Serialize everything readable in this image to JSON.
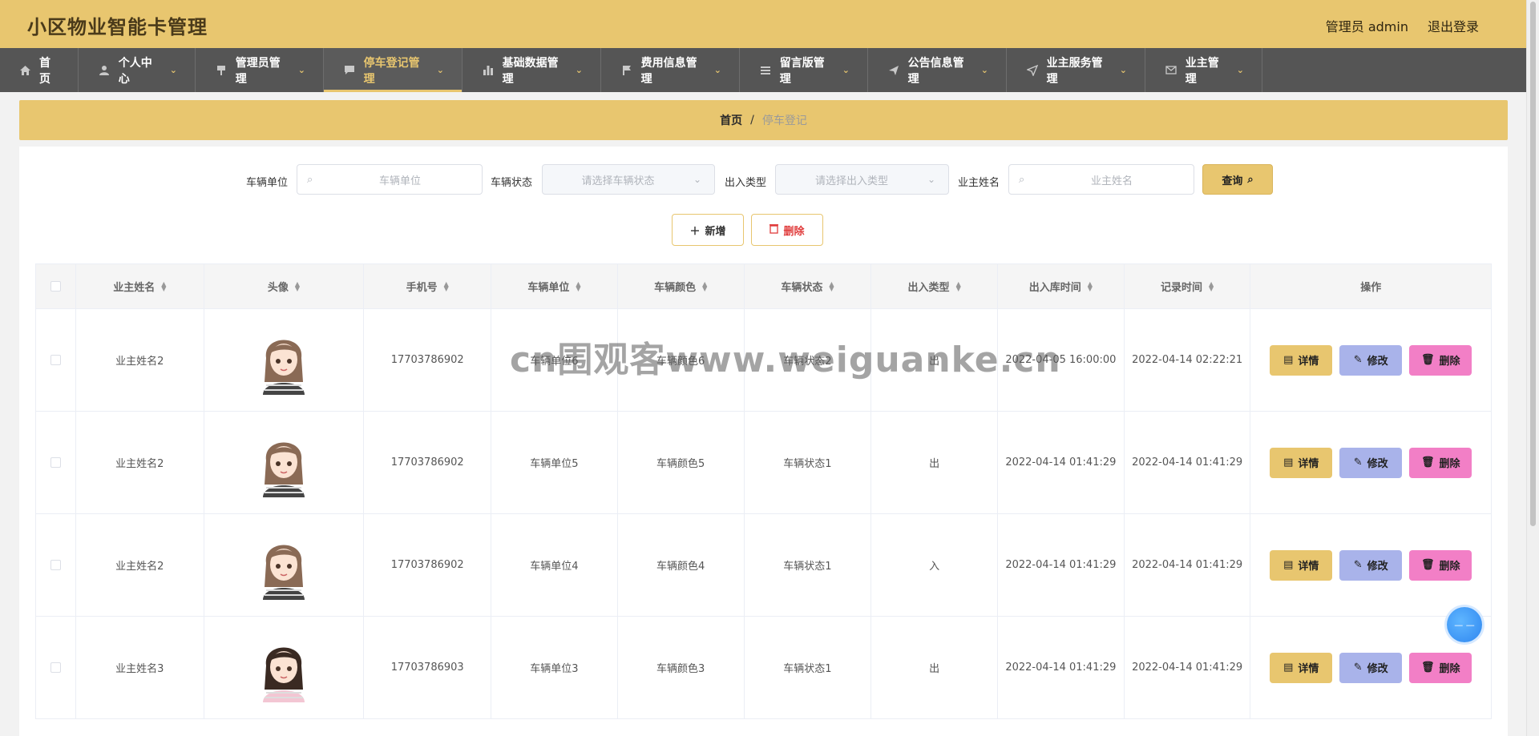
{
  "header": {
    "title": "小区物业智能卡管理",
    "user": "管理员 admin",
    "logout": "退出登录"
  },
  "nav": [
    {
      "label": "首页",
      "icon": "home-icon",
      "chevron": false,
      "active": false
    },
    {
      "label": "个人中心",
      "icon": "user-icon",
      "chevron": true,
      "active": false
    },
    {
      "label": "管理员管理",
      "icon": "admin-icon",
      "chevron": true,
      "active": false
    },
    {
      "label": "停车登记管理",
      "icon": "chat-icon",
      "chevron": true,
      "active": true
    },
    {
      "label": "基础数据管理",
      "icon": "chart-icon",
      "chevron": true,
      "active": false
    },
    {
      "label": "费用信息管理",
      "icon": "flag-icon",
      "chevron": true,
      "active": false
    },
    {
      "label": "留言版管理",
      "icon": "list-icon",
      "chevron": true,
      "active": false
    },
    {
      "label": "公告信息管理",
      "icon": "send-icon",
      "chevron": true,
      "active": false
    },
    {
      "label": "业主服务管理",
      "icon": "navigate-icon",
      "chevron": true,
      "active": false
    },
    {
      "label": "业主管理",
      "icon": "mail-icon",
      "chevron": true,
      "active": false
    }
  ],
  "breadcrumb": {
    "home": "首页",
    "separator": "/",
    "current": "停车登记"
  },
  "filters": {
    "unit_label": "车辆单位",
    "unit_placeholder": "车辆单位",
    "status_label": "车辆状态",
    "status_placeholder": "请选择车辆状态",
    "type_label": "出入类型",
    "type_placeholder": "请选择出入类型",
    "owner_label": "业主姓名",
    "owner_placeholder": "业主姓名",
    "query": "查询"
  },
  "actions": {
    "add": "新增",
    "delete": "删除"
  },
  "table": {
    "headers": [
      "业主姓名",
      "头像",
      "手机号",
      "车辆单位",
      "车辆颜色",
      "车辆状态",
      "出入类型",
      "出入库时间",
      "记录时间",
      "操作"
    ],
    "op_labels": {
      "detail": "详情",
      "edit": "修改",
      "remove": "删除"
    },
    "rows": [
      {
        "owner": "业主姓名2",
        "phone": "17703786902",
        "unit": "车辆单位6",
        "color": "车辆颜色6",
        "status": "车辆状态2",
        "type": "出",
        "in_out_time": "2022-04-05 16:00:00",
        "record_time": "2022-04-14 02:22:21"
      },
      {
        "owner": "业主姓名2",
        "phone": "17703786902",
        "unit": "车辆单位5",
        "color": "车辆颜色5",
        "status": "车辆状态1",
        "type": "出",
        "in_out_time": "2022-04-14 01:41:29",
        "record_time": "2022-04-14 01:41:29"
      },
      {
        "owner": "业主姓名2",
        "phone": "17703786902",
        "unit": "车辆单位4",
        "color": "车辆颜色4",
        "status": "车辆状态1",
        "type": "入",
        "in_out_time": "2022-04-14 01:41:29",
        "record_time": "2022-04-14 01:41:29"
      },
      {
        "owner": "业主姓名3",
        "phone": "17703786903",
        "unit": "车辆单位3",
        "color": "车辆颜色3",
        "status": "车辆状态1",
        "type": "出",
        "in_out_time": "2022-04-14 01:41:29",
        "record_time": "2022-04-14 01:41:29"
      }
    ]
  },
  "watermark": "cn围观客www.weiguanke.cn",
  "colors": {
    "brand": "#e8c66f",
    "nav_bg": "#555555",
    "edit": "#a9b3ea",
    "remove": "#f27fc6"
  }
}
